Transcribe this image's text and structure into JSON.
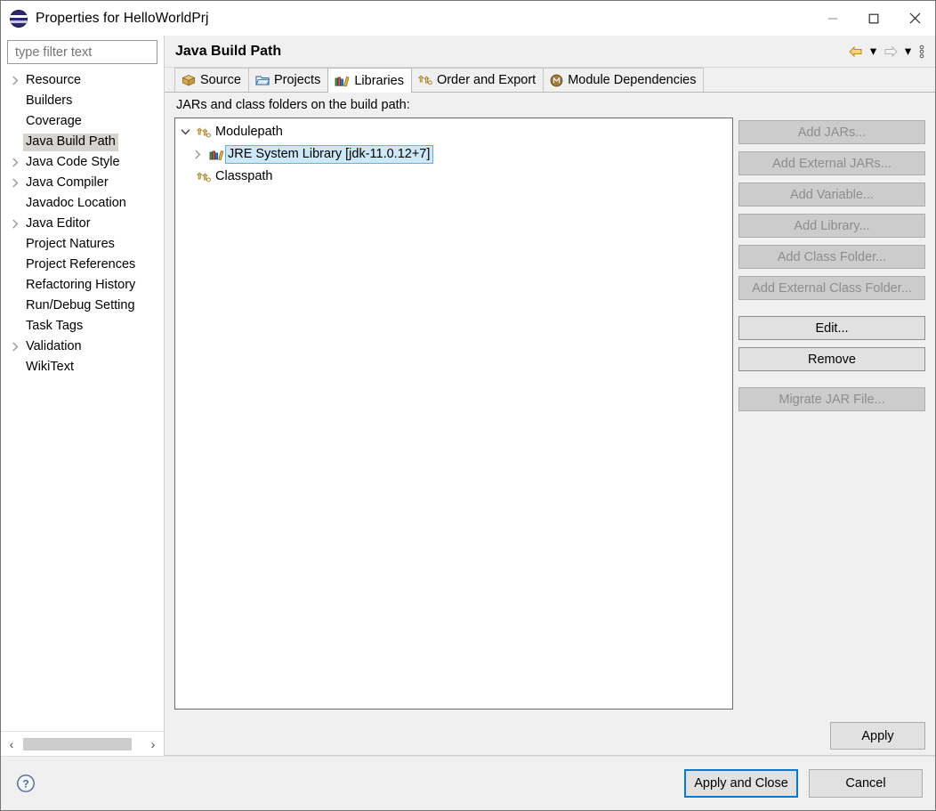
{
  "window": {
    "title": "Properties for HelloWorldPrj",
    "icon": "eclipse-icon",
    "minimize_label": "—",
    "maximize_label": "□",
    "close_label": "✕"
  },
  "sidebar": {
    "filter": {
      "placeholder": "type filter text",
      "value": ""
    },
    "items": [
      {
        "label": "Resource",
        "expandable": true,
        "selected": false
      },
      {
        "label": "Builders",
        "expandable": false,
        "selected": false
      },
      {
        "label": "Coverage",
        "expandable": false,
        "selected": false
      },
      {
        "label": "Java Build Path",
        "expandable": false,
        "selected": true
      },
      {
        "label": "Java Code Style",
        "expandable": true,
        "selected": false
      },
      {
        "label": "Java Compiler",
        "expandable": true,
        "selected": false
      },
      {
        "label": "Javadoc Location",
        "expandable": false,
        "selected": false
      },
      {
        "label": "Java Editor",
        "expandable": true,
        "selected": false
      },
      {
        "label": "Project Natures",
        "expandable": false,
        "selected": false
      },
      {
        "label": "Project References",
        "expandable": false,
        "selected": false
      },
      {
        "label": "Refactoring History",
        "expandable": false,
        "selected": false
      },
      {
        "label": "Run/Debug Setting",
        "expandable": false,
        "selected": false
      },
      {
        "label": "Task Tags",
        "expandable": false,
        "selected": false
      },
      {
        "label": "Validation",
        "expandable": true,
        "selected": false
      },
      {
        "label": "WikiText",
        "expandable": false,
        "selected": false
      }
    ],
    "scroll_left_label": "‹",
    "scroll_right_label": "›"
  },
  "page": {
    "title": "Java Build Path",
    "nav": {
      "back_icon": "back-arrow-icon",
      "back_caret": "▾",
      "forward_icon": "forward-arrow-icon",
      "forward_caret": "▾",
      "menu_icon": "view-menu-icon"
    }
  },
  "tabs": [
    {
      "label": "Source",
      "icon": "source-package-icon",
      "active": false
    },
    {
      "label": "Projects",
      "icon": "folder-icon",
      "active": false
    },
    {
      "label": "Libraries",
      "icon": "libraries-books-icon",
      "active": true
    },
    {
      "label": "Order and Export",
      "icon": "order-export-icon",
      "active": false
    },
    {
      "label": "Module Dependencies",
      "icon": "module-icon",
      "active": false
    }
  ],
  "libraries_panel": {
    "label": "JARs and class folders on the build path:",
    "tree": [
      {
        "label": "Modulepath",
        "icon": "modulepath-icon",
        "expander": "ⱟ",
        "expanded": true,
        "indent": 0,
        "selected": false
      },
      {
        "label": "JRE System Library [jdk-11.0.12+7]",
        "icon": "jre-library-icon",
        "expander": "›",
        "expanded": false,
        "indent": 1,
        "selected": true
      },
      {
        "label": "Classpath",
        "icon": "classpath-icon",
        "expander": "",
        "expanded": false,
        "indent": 0,
        "selected": false
      }
    ],
    "buttons": [
      {
        "label": "Add JARs...",
        "enabled": false,
        "group": 0
      },
      {
        "label": "Add External JARs...",
        "enabled": false,
        "group": 0
      },
      {
        "label": "Add Variable...",
        "enabled": false,
        "group": 0
      },
      {
        "label": "Add Library...",
        "enabled": false,
        "group": 0
      },
      {
        "label": "Add Class Folder...",
        "enabled": false,
        "group": 0
      },
      {
        "label": "Add External Class Folder...",
        "enabled": false,
        "group": 0
      },
      {
        "label": "Edit...",
        "enabled": true,
        "group": 1
      },
      {
        "label": "Remove",
        "enabled": true,
        "group": 1
      },
      {
        "label": "Migrate JAR File...",
        "enabled": false,
        "group": 2
      }
    ]
  },
  "actions": {
    "apply": "Apply",
    "apply_and_close": "Apply and Close",
    "cancel": "Cancel",
    "help_icon": "help-question-icon"
  },
  "colors": {
    "dialog_bg": "#f0f0f0",
    "selection_blue": "#cde8f9",
    "selection_border": "#5fb4e4",
    "sidebar_selection": "#d6d3d0",
    "focus_border": "#0078d7",
    "tab_active_bg": "#ffffff",
    "icon_gold": "#e8a33d"
  }
}
